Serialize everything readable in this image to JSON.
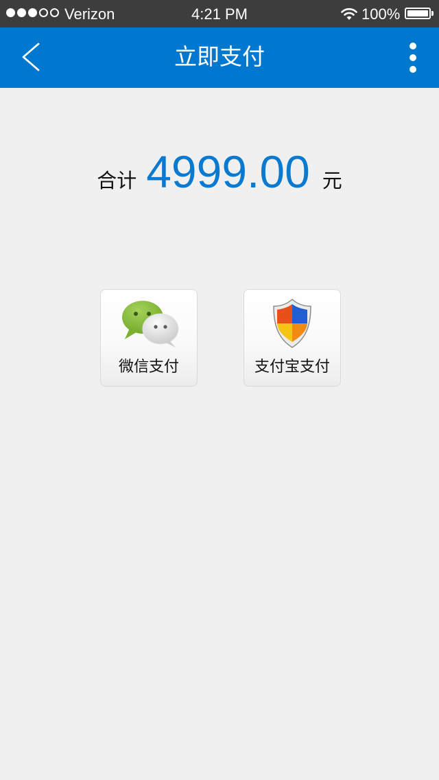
{
  "status_bar": {
    "carrier": "Verizon",
    "time": "4:21 PM",
    "battery": "100%",
    "signal_bars": 3,
    "signal_max": 5
  },
  "nav": {
    "title": "立即支付",
    "back_icon": "back-chevron-icon",
    "more_icon": "more-vertical-icon"
  },
  "summary": {
    "label": "合计",
    "amount": "4999.00",
    "unit": "元"
  },
  "payment_methods": [
    {
      "label": "微信支付",
      "icon": "wechat-icon"
    },
    {
      "label": "支付宝支付",
      "icon": "alipay-shield-icon"
    }
  ],
  "colors": {
    "nav_background": "#0078d0",
    "amount": "#0a7ad1",
    "page_background": "#f0f0f0"
  }
}
